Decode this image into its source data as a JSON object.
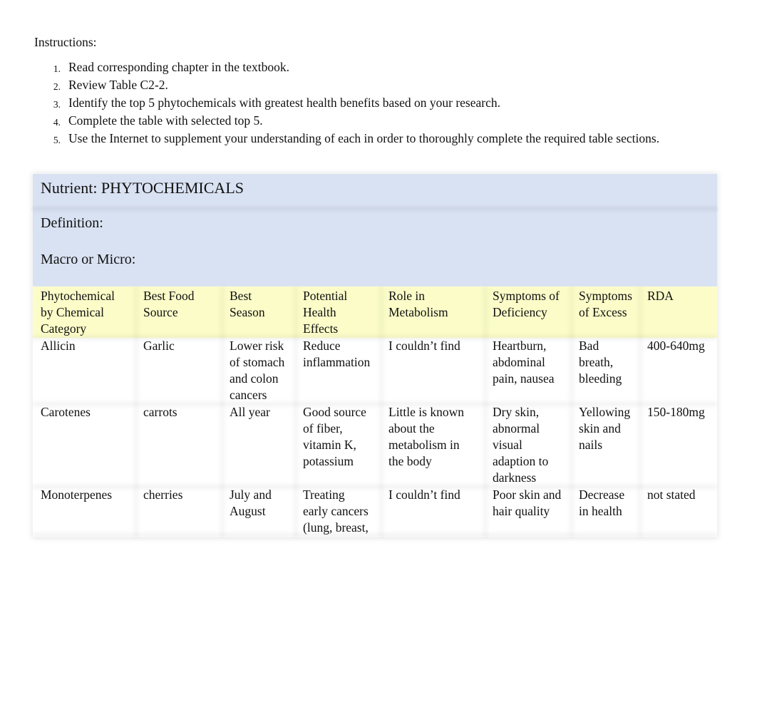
{
  "instructions": {
    "label": "Instructions:",
    "items": [
      {
        "num": "1.",
        "text": "Read corresponding chapter in the textbook."
      },
      {
        "num": "2.",
        "text": "Review Table C2-2."
      },
      {
        "num": "3.",
        "text": "Identify the top 5 phytochemicals with greatest health benefits based on your research."
      },
      {
        "num": "4.",
        "text": "Complete the table with selected top 5."
      },
      {
        "num": "5.",
        "text": "Use the Internet to supplement your understanding of each in order to thoroughly complete the required table sections."
      }
    ]
  },
  "table": {
    "nutrient_title": "Nutrient: PHYTOCHEMICALS",
    "definition_label": "Definition:",
    "macro_label": "Macro or Micro:",
    "colors": {
      "header_band": "#d9e2f2",
      "column_header_band": "#fbfcc8"
    },
    "headers": [
      [
        "Phytochemical",
        "by Chemical",
        "Category"
      ],
      [
        "Best Food",
        "Source"
      ],
      [
        "Best",
        "Season"
      ],
      [
        "Potential",
        "Health",
        "Effects"
      ],
      [
        "Role in",
        "Metabolism"
      ],
      [
        "Symptoms of",
        "Deficiency"
      ],
      [
        "Symptoms",
        "of Excess"
      ],
      [
        "RDA"
      ]
    ],
    "rows": [
      [
        [
          "Allicin"
        ],
        [
          "Garlic"
        ],
        [
          "Lower risk",
          "of stomach",
          "and colon",
          "cancers"
        ],
        [
          "Reduce",
          "inflammation"
        ],
        [
          "I couldn’t find"
        ],
        [
          "Heartburn,",
          "abdominal",
          "pain, nausea"
        ],
        [
          "Bad",
          "breath,",
          "bleeding"
        ],
        [
          "400-640mg"
        ]
      ],
      [
        [
          "Carotenes"
        ],
        [
          "carrots"
        ],
        [
          "All year"
        ],
        [
          "Good source",
          "of fiber,",
          "vitamin K,",
          "potassium"
        ],
        [
          "Little is known",
          "about the",
          "metabolism in",
          "the body"
        ],
        [
          "Dry skin,",
          "abnormal",
          "visual",
          "adaption to",
          "darkness"
        ],
        [
          "Yellowing",
          "skin and",
          "nails"
        ],
        [
          "150-180mg"
        ]
      ],
      [
        [
          "Monoterpenes"
        ],
        [
          "cherries"
        ],
        [
          "July and",
          "August"
        ],
        [
          "Treating",
          "early cancers",
          "(lung, breast,"
        ],
        [
          "I couldn’t find"
        ],
        [
          "Poor skin and",
          "hair quality"
        ],
        [
          "Decrease",
          "in health"
        ],
        [
          "not stated"
        ]
      ]
    ]
  }
}
